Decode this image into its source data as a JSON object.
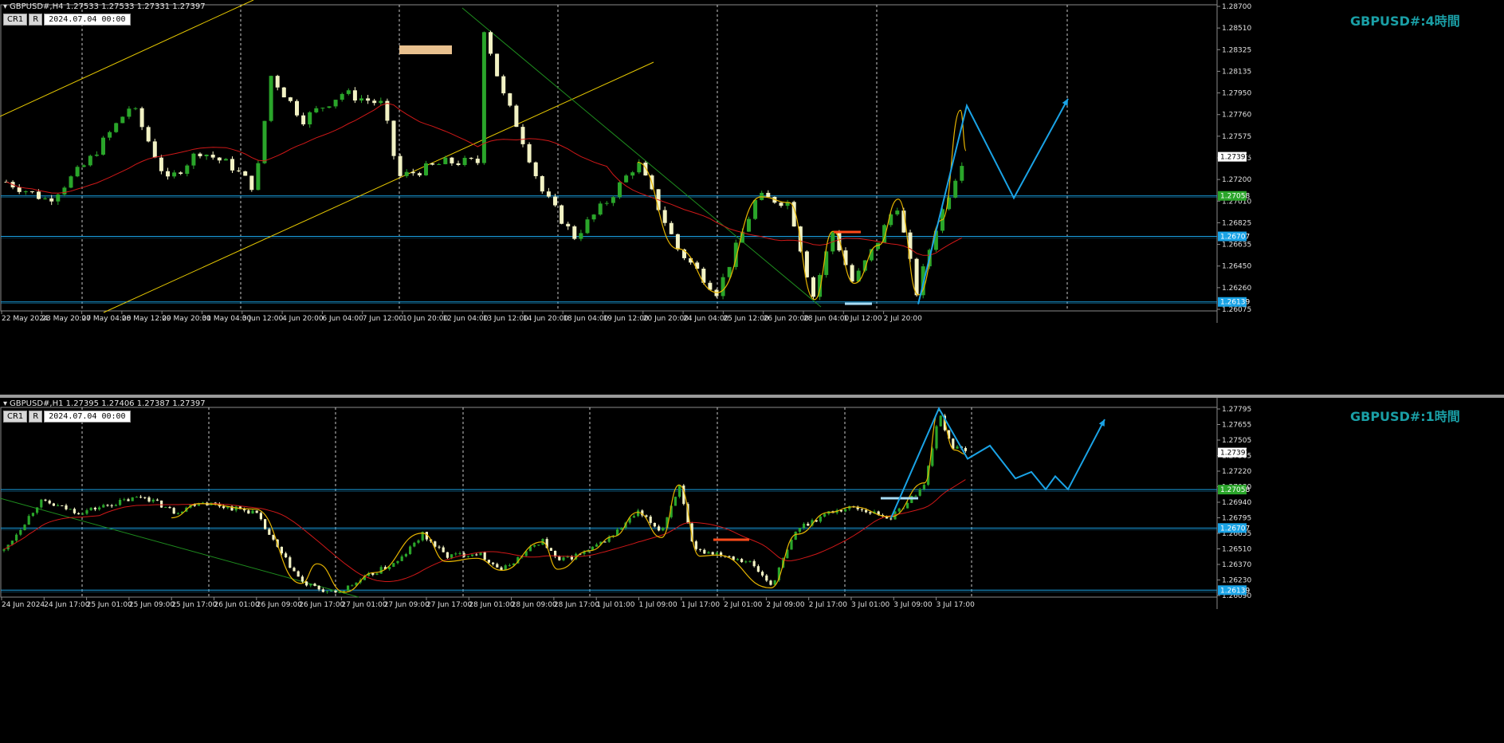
{
  "panels": {
    "top": {
      "info": "GBPUSD#,H4  1.27533 1.27533 1.27331 1.27397",
      "btn_cr": "CR1",
      "btn_r": "R",
      "date": "2024.07.04  00:00",
      "title": "GBPUSD#:4時間"
    },
    "bottom": {
      "info": "GBPUSD#,H1  1.27395 1.27406 1.27387 1.27397",
      "btn_cr": "CR1",
      "btn_r": "R",
      "date": "2024.07.04  00:00",
      "title": "GBPUSD#:1時間"
    }
  },
  "chart_data": [
    {
      "type": "candlestick",
      "symbol": "GBPUSD#",
      "timeframe": "H4",
      "title": "GBPUSD#:4時間",
      "ohlc_last": [
        1.27533,
        1.27533,
        1.27331,
        1.27397
      ],
      "ylim": [
        1.26075,
        1.287
      ],
      "y_ticks": [
        "1.28700",
        "1.28510",
        "1.28325",
        "1.28135",
        "1.27950",
        "1.27760",
        "1.27575",
        "1.27385",
        "1.27200",
        "1.27010",
        "1.26825",
        "1.26635",
        "1.26450",
        "1.26260",
        "1.26075"
      ],
      "x_labels": [
        "22 May 2024",
        "23 May 20:00",
        "27 May 04:00",
        "28 May 12:00",
        "29 May 20:00",
        "31 May 04:00",
        "3 Jun 12:00",
        "4 Jun 20:00",
        "6 Jun 04:00",
        "7 Jun 12:00",
        "10 Jun 20:00",
        "12 Jun 04:00",
        "13 Jun 12:00",
        "14 Jun 20:00",
        "18 Jun 04:00",
        "19 Jun 12:00",
        "20 Jun 20:00",
        "24 Jun 04:00",
        "25 Jun 12:00",
        "26 Jun 20:00",
        "28 Jun 04:00",
        "1 Jul 12:00",
        "2 Jul 20:00"
      ],
      "price_tags": [
        {
          "text": "1.27397",
          "color": "#ffffff"
        },
        {
          "text": "1.27058",
          "color": "#2aa52a"
        },
        {
          "text": "1.26707",
          "color": "#1aa3e6"
        },
        {
          "text": "1.26139",
          "color": "#1aa3e6"
        }
      ],
      "horizontal_levels": [
        1.27058,
        1.26707,
        1.26139
      ],
      "grid": true,
      "colors": {
        "up": "#2aa52a",
        "down": "#f2f2c4",
        "ma": "#d01818",
        "zigzag": "#e6b400",
        "forecast": "#1aa3e6",
        "channel": "#e6c800",
        "trendline": "#1e8c1e",
        "level": "#1aa3e6"
      }
    },
    {
      "type": "candlestick",
      "symbol": "GBPUSD#",
      "timeframe": "H1",
      "title": "GBPUSD#:1時間",
      "ohlc_last": [
        1.27395,
        1.27406,
        1.27387,
        1.27397
      ],
      "ylim": [
        1.2609,
        1.27795
      ],
      "y_ticks": [
        "1.27795",
        "1.27655",
        "1.27505",
        "1.27365",
        "1.27220",
        "1.27080",
        "1.26940",
        "1.26795",
        "1.26655",
        "1.26510",
        "1.26370",
        "1.26230",
        "1.26090"
      ],
      "x_labels": [
        "24 Jun 2024",
        "24 Jun 17:00",
        "25 Jun 01:00",
        "25 Jun 09:00",
        "25 Jun 17:00",
        "26 Jun 01:00",
        "26 Jun 09:00",
        "26 Jun 17:00",
        "27 Jun 01:00",
        "27 Jun 09:00",
        "27 Jun 17:00",
        "28 Jun 01:00",
        "28 Jun 09:00",
        "28 Jun 17:00",
        "1 Jul 01:00",
        "1 Jul 09:00",
        "1 Jul 17:00",
        "2 Jul 01:00",
        "2 Jul 09:00",
        "2 Jul 17:00",
        "3 Jul 01:00",
        "3 Jul 09:00",
        "3 Jul 17:00"
      ],
      "price_tags": [
        {
          "text": "1.27397",
          "color": "#ffffff"
        },
        {
          "text": "1.27058",
          "color": "#2aa52a"
        },
        {
          "text": "1.26707",
          "color": "#1aa3e6"
        },
        {
          "text": "1.26139",
          "color": "#1aa3e6"
        }
      ],
      "horizontal_levels": [
        1.27058,
        1.26707,
        1.26139
      ],
      "grid": true,
      "colors": {
        "up": "#2aa52a",
        "down": "#f2f2c4",
        "ma": "#d01818",
        "zigzag": "#e6b400",
        "forecast": "#1aa3e6",
        "trendline": "#1e8c1e",
        "level": "#1aa3e6"
      }
    }
  ]
}
